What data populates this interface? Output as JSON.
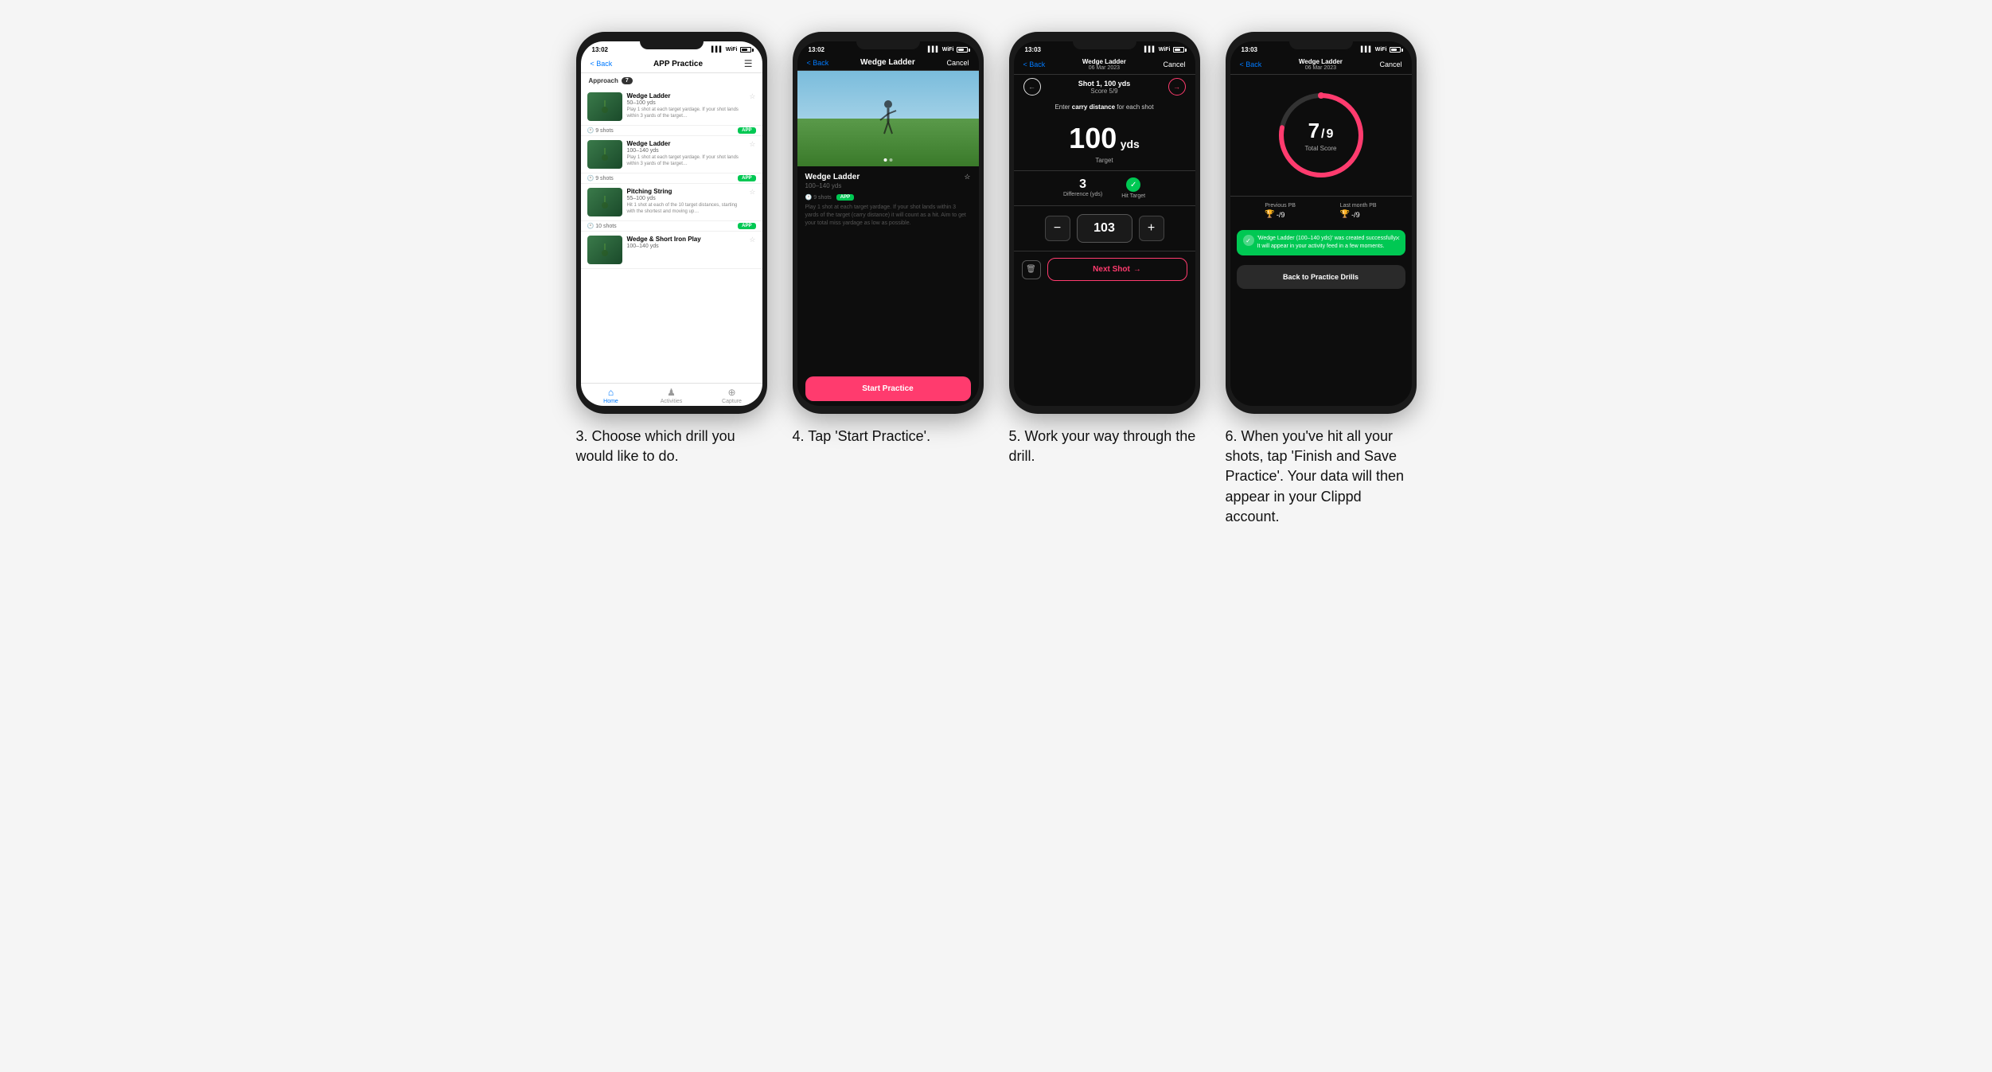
{
  "page": {
    "background": "#f5f5f5"
  },
  "phones": [
    {
      "id": "phone1",
      "screen": "app-practice",
      "status_bar": {
        "time": "13:02",
        "dark": false
      },
      "nav": {
        "back_label": "< Back",
        "title": "APP Practice",
        "right_icon": "hamburger"
      },
      "section": {
        "label": "Approach",
        "count": "7"
      },
      "drills": [
        {
          "name": "Wedge Ladder",
          "range": "50–100 yds",
          "desc": "Play 1 shot at each target yardage. If your shot lands within 3 yards of the target…",
          "shots": "9 shots",
          "badge": "APP"
        },
        {
          "name": "Wedge Ladder",
          "range": "100–140 yds",
          "desc": "Play 1 shot at each target yardage. If your shot lands within 3 yards of the target…",
          "shots": "9 shots",
          "badge": "APP"
        },
        {
          "name": "Pitching String",
          "range": "55–100 yds",
          "desc": "Hit 1 shot at each of the 10 target distances, starting with the shortest and moving up…",
          "shots": "10 shots",
          "badge": "APP"
        },
        {
          "name": "Wedge & Short Iron Play",
          "range": "100–140 yds",
          "desc": "",
          "shots": "",
          "badge": ""
        }
      ],
      "bottom_nav": [
        {
          "label": "Home",
          "icon": "🏠",
          "active": true
        },
        {
          "label": "Activities",
          "icon": "📊",
          "active": false
        },
        {
          "label": "Capture",
          "icon": "➕",
          "active": false
        }
      ],
      "caption": "3. Choose which drill you would like to do."
    },
    {
      "id": "phone2",
      "screen": "drill-detail",
      "status_bar": {
        "time": "13:02",
        "dark": true
      },
      "nav": {
        "back_label": "< Back",
        "title": "Wedge Ladder",
        "right_label": "Cancel",
        "dark": true
      },
      "drill": {
        "name": "Wedge Ladder",
        "range": "100–140 yds",
        "shots": "9 shots",
        "badge": "APP",
        "desc": "Play 1 shot at each target yardage. If your shot lands within 3 yards of the target (carry distance) it will count as a hit. Aim to get your total miss yardage as low as possible."
      },
      "start_btn_label": "Start Practice",
      "caption": "4. Tap 'Start Practice'."
    },
    {
      "id": "phone3",
      "screen": "shot-entry",
      "status_bar": {
        "time": "13:03",
        "dark": true
      },
      "nav": {
        "back_label": "< Back",
        "title": "Wedge Ladder",
        "subtitle": "06 Mar 2023",
        "right_label": "Cancel",
        "dark": true
      },
      "shot": {
        "label": "Shot 1, 100 yds",
        "score": "Score 5/9",
        "instruction": "Enter carry distance for each shot",
        "target_yds": "100",
        "target_unit": "yds",
        "target_label": "Target",
        "difference": "3",
        "difference_label": "Difference (yds)",
        "hit_target_label": "Hit Target",
        "input_value": "103"
      },
      "next_shot_label": "Next Shot",
      "caption": "5. Work your way through the drill."
    },
    {
      "id": "phone4",
      "screen": "results",
      "status_bar": {
        "time": "13:03",
        "dark": true
      },
      "nav": {
        "back_label": "< Back",
        "title": "Wedge Ladder",
        "subtitle": "06 Mar 2023",
        "right_label": "Cancel",
        "dark": true
      },
      "results": {
        "score": "7",
        "total": "9",
        "label": "Total Score",
        "previous_pb_label": "Previous PB",
        "previous_pb_value": "-/9",
        "last_month_pb_label": "Last month PB",
        "last_month_pb_value": "-/9"
      },
      "toast": {
        "text": "'Wedge Ladder (100–140 yds)' was created successfully. It will appear in your activity feed in a few moments."
      },
      "back_btn_label": "Back to Practice Drills",
      "caption": "6. When you've hit all your shots, tap 'Finish and Save Practice'. Your data will then appear in your Clippd account."
    }
  ]
}
